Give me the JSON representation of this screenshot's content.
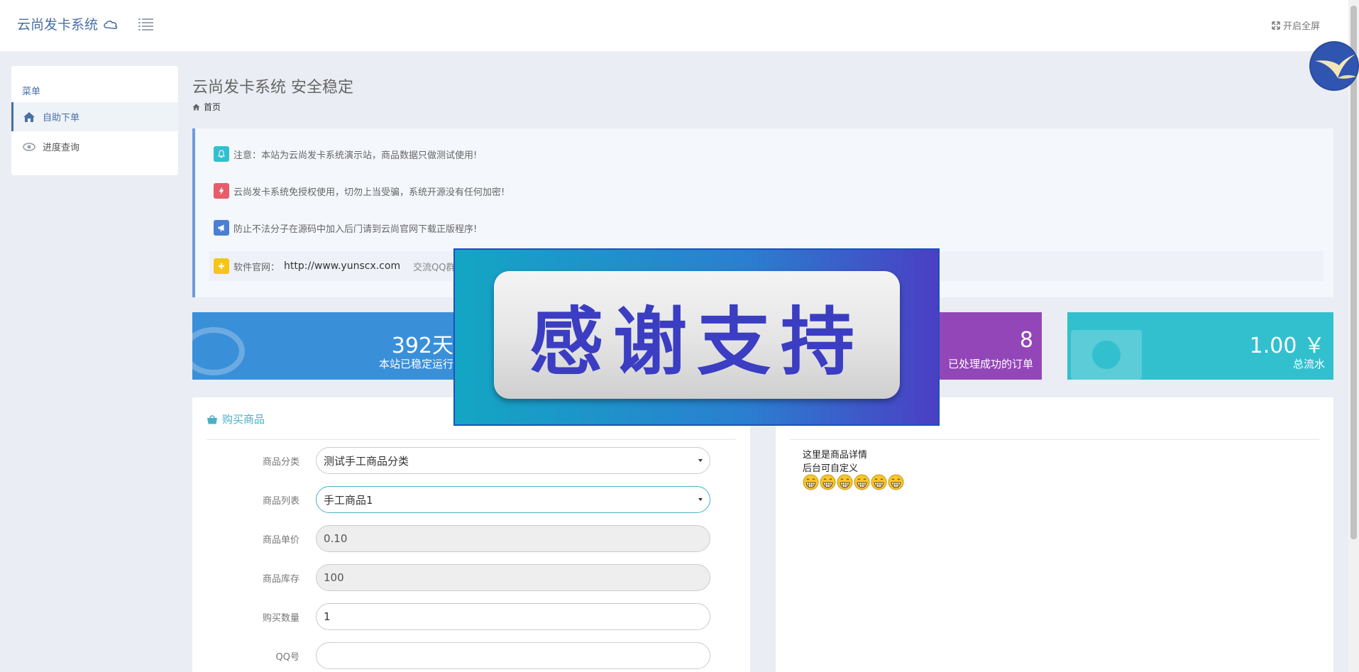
{
  "header": {
    "brand": "云尚发卡系统",
    "fullscreen_label": "开启全屏"
  },
  "sidebar": {
    "title": "菜单",
    "items": [
      {
        "label": "自助下单",
        "icon": "home-icon",
        "active": true
      },
      {
        "label": "进度查询",
        "icon": "eye-icon",
        "active": false
      }
    ]
  },
  "page": {
    "title": "云尚发卡系统 安全稳定",
    "breadcrumb": "首页"
  },
  "notices": [
    {
      "icon": "bell-icon",
      "color": "#32c0cf",
      "text": "注意：本站为云尚发卡系统演示站，商品数据只做测试使用!"
    },
    {
      "icon": "lightning-icon",
      "color": "#e85d6a",
      "text": "云尚发卡系统免授权使用，切勿上当受骗，系统开源没有任何加密!"
    },
    {
      "icon": "megaphone-icon",
      "color": "#4a7fd4",
      "text": "防止不法分子在源码中加入后门请到云尚官网下载正版程序!"
    },
    {
      "icon": "plus-icon",
      "color": "#f5c518",
      "label": "软件官网：",
      "url": "http://www.yunscx.com",
      "qq": "交流QQ群"
    }
  ],
  "stats": [
    {
      "value": "392天",
      "label": "本站已稳定运行"
    },
    {
      "value": "8",
      "label": "已处理成功的订单"
    },
    {
      "value": "1.00 ￥",
      "label": "总流水"
    }
  ],
  "buy": {
    "title": "购买商品",
    "fields": [
      {
        "label": "商品分类",
        "value": "测试手工商品分类",
        "type": "select"
      },
      {
        "label": "商品列表",
        "value": "手工商品1",
        "type": "select"
      },
      {
        "label": "商品单价",
        "value": "0.10",
        "type": "readonly"
      },
      {
        "label": "商品库存",
        "value": "100",
        "type": "readonly"
      },
      {
        "label": "购买数量",
        "value": "1",
        "type": "input"
      },
      {
        "label": "QQ号",
        "value": "",
        "type": "input"
      }
    ]
  },
  "detail": {
    "line1": "这里是商品详情",
    "line2": "后台可自定义",
    "emoji_count": 6
  },
  "banner": {
    "text": "感谢支持"
  },
  "colors": {
    "primary": "#4a6fa5",
    "stat_blue": "#3a8fd9",
    "stat_purple": "#9346b8",
    "stat_teal": "#32c0cf"
  }
}
